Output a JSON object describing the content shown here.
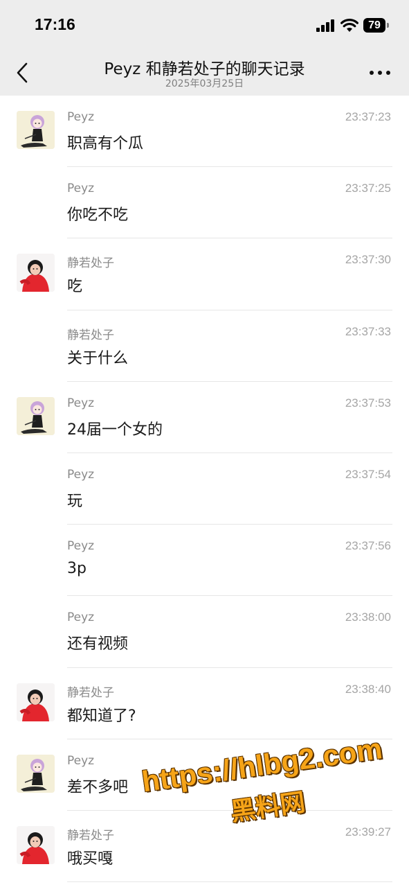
{
  "status_bar": {
    "time": "17:16",
    "battery": "79",
    "icons": [
      "cellular-signal-icon",
      "wifi-icon",
      "battery-icon"
    ]
  },
  "nav": {
    "title": "Peyz 和静若处子的聊天记录",
    "date": "2025年03月25日",
    "back_icon": "chevron-left-icon",
    "more_icon": "more-dots-icon"
  },
  "messages": [
    {
      "sender": "Peyz",
      "time": "23:37:23",
      "text": "职高有个瓜",
      "avatar": "anime-avatar"
    },
    {
      "sender": "Peyz",
      "time": "23:37:25",
      "text": "你吃不吃",
      "avatar": ""
    },
    {
      "sender": "静若处子",
      "time": "23:37:30",
      "text": "吃",
      "avatar": "child-red-coat-avatar"
    },
    {
      "sender": "静若处子",
      "time": "23:37:33",
      "text": "关于什么",
      "avatar": ""
    },
    {
      "sender": "Peyz",
      "time": "23:37:53",
      "text": "24届一个女的",
      "avatar": "anime-avatar"
    },
    {
      "sender": "Peyz",
      "time": "23:37:54",
      "text": "玩",
      "avatar": ""
    },
    {
      "sender": "Peyz",
      "time": "23:37:56",
      "text": "3p",
      "avatar": ""
    },
    {
      "sender": "Peyz",
      "time": "23:38:00",
      "text": "还有视频",
      "avatar": ""
    },
    {
      "sender": "静若处子",
      "time": "23:38:40",
      "text": "都知道了?",
      "avatar": "child-red-coat-avatar"
    },
    {
      "sender": "Peyz",
      "time": "",
      "text": "差不多吧",
      "avatar": "anime-avatar"
    },
    {
      "sender": "静若处子",
      "time": "23:39:27",
      "text": "哦买嘎",
      "avatar": "child-red-coat-avatar"
    }
  ],
  "watermark": {
    "url": "https://hlbg2.com",
    "name": "黑料网"
  },
  "colors": {
    "header_bg": "#ededed",
    "divider": "#e6e6e6",
    "meta_text": "#8a8a8a",
    "watermark_fill": "#f6a418"
  }
}
